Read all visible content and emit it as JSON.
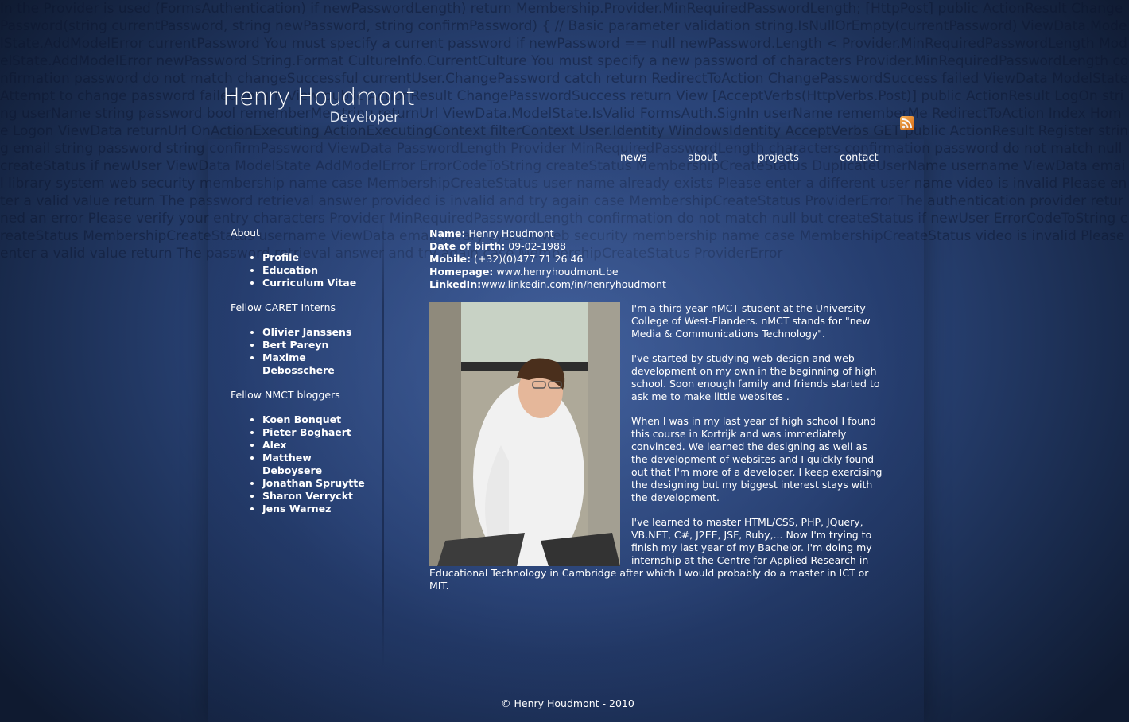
{
  "background_code": "In the Provider is used (FormsAuthentication) if newPasswordLength) return Membership.Provider.MinRequiredPasswordLength; [HttpPost] public ActionResult ChangePassword(string currentPassword, string newPassword, string confirmPassword) { // Basic parameter validation string.IsNullOrEmpty(currentPassword) ViewData.ModelState.AddModelError currentPassword You must specify a current password if newPassword == null newPassword.Length < Provider.MinRequiredPasswordLength ModelState.AddModelError newPassword String.Format CultureInfo.CurrentCulture You must specify a new password of characters Provider.MinRequiredPasswordLength confirmation password do not match changeSuccessful currentUser.ChangePassword catch return RedirectToAction ChangePasswordSuccess failed ViewData ModelState Attempt to change password failed return View public ActionResult ChangePasswordSuccess return View [AcceptVerbs(HttpVerbs.Post)] public ActionResult LogOn string userName string password bool rememberMe string returnUrl ViewData.ModelState.IsValid FormsAuth.SignIn userName rememberMe RedirectToAction Index Home Logon ViewData returnUrl OnActionExecuting ActionExecutingContext filterContext User.Identity WindowsIdentity AcceptVerbs GET public ActionResult Register string email string password string confirmPassword ViewData PasswordLength Provider MinRequiredPasswordLength characters confirmation password do not match null createStatus if newUser ViewData ModelState AddModelError ErrorCodeToString createStatus MembershipCreateStatus DuplicateUserName username ViewData email library system web security membership name case MembershipCreateStatus user name already exists Please enter a different user name video is invalid Please enter a valid value return The password retrieval answer provided is invalid and try again case MembershipCreateStatus ProviderError The authentication provider returned an error Please verify your entry characters Provider MinRequiredPasswordLength confirmation do not match null but createStatus if newUser ErrorCodeToString createStatus MembershipCreateStatus username ViewData email library system web security membership name case MembershipCreateStatus video is invalid Please enter a valid value return The password retrieval answer and try again case MembershipCreateStatus ProviderError",
  "header": {
    "name": "Henry Houdmont",
    "role": "Developer"
  },
  "nav": [
    {
      "label": "news"
    },
    {
      "label": "about"
    },
    {
      "label": "projects"
    },
    {
      "label": "contact"
    }
  ],
  "sidebar": {
    "sections": [
      {
        "title": "About",
        "items": [
          "Profile",
          "Education",
          "Curriculum Vitae"
        ]
      },
      {
        "title": "Fellow CARET Interns",
        "items": [
          "Olivier Janssens",
          "Bert Pareyn",
          "Maxime Debosschere"
        ]
      },
      {
        "title": "Fellow NMCT bloggers",
        "items": [
          "Koen Bonquet",
          "Pieter Boghaert",
          "Alex",
          "Matthew Deboysere",
          "Jonathan Spruytte",
          "Sharon Verryckt",
          "Jens Warnez"
        ]
      }
    ]
  },
  "info": {
    "name_label": "Name:",
    "name_value": "Henry Houdmont",
    "dob_label": "Date of birth:",
    "dob_value": "09-02-1988",
    "mobile_label": "Mobile:",
    "mobile_value": "(+32)(0)477 71 26 46",
    "homepage_label": "Homepage:",
    "homepage_value": "www.henryhoudmont.be",
    "linkedin_label": "LinkedIn:",
    "linkedin_value": "www.linkedin.com/in/henryhoudmont"
  },
  "bio": [
    "I'm a third year nMCT student at the University College of West-Flanders. nMCT stands for \"new Media & Communications Technology\".",
    "I've started by studying web design and web development on my own in the beginning of high school. Soon enough family and friends started to ask me to make little websites .",
    "When I was in my last year of high school I found this course in Kortrijk and was immediately convinced. We learned the designing as well as the development of websites and I quickly found out that I'm more of a developer. I keep exercising the designing but my biggest interest stays with the development.",
    "I've learned to master HTML/CSS, PHP, JQuery, VB.NET, C#, J2EE, JSF, Ruby,... Now I'm trying to finish my last year of my Bachelor. I'm doing my internship at the Centre for Applied Research in Educational Technology in Cambridge after which I would probably do a master in ICT or MIT."
  ],
  "footer": "© Henry Houdmont - 2010",
  "colors": {
    "accent": "#2a4478",
    "rss": "#e8832a"
  }
}
